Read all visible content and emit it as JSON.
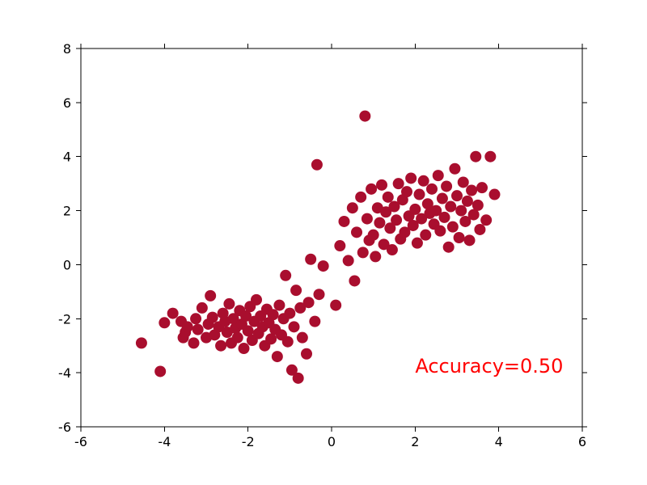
{
  "chart_data": {
    "type": "scatter",
    "title": "",
    "xlabel": "",
    "ylabel": "",
    "xlim": [
      -6,
      6
    ],
    "ylim": [
      -6,
      8
    ],
    "x_ticks": [
      -6,
      -4,
      -2,
      0,
      2,
      4,
      6
    ],
    "y_ticks": [
      -6,
      -4,
      -2,
      0,
      2,
      4,
      6,
      8
    ],
    "annotation": {
      "text": "Accuracy=0.50",
      "x": 2.0,
      "y": -4.0,
      "color": "#ff0000"
    },
    "marker_color": "#a90e2e",
    "marker_radius": 7,
    "series": [
      {
        "name": "points",
        "points": [
          [
            -4.55,
            -2.9
          ],
          [
            -4.1,
            -3.95
          ],
          [
            -4.0,
            -2.15
          ],
          [
            -3.8,
            -1.8
          ],
          [
            -3.6,
            -2.1
          ],
          [
            -3.55,
            -2.7
          ],
          [
            -3.5,
            -2.5
          ],
          [
            -3.45,
            -2.3
          ],
          [
            -3.3,
            -2.9
          ],
          [
            -3.25,
            -2.0
          ],
          [
            -3.2,
            -2.4
          ],
          [
            -3.1,
            -1.6
          ],
          [
            -3.0,
            -2.7
          ],
          [
            -2.95,
            -2.2
          ],
          [
            -2.9,
            -1.15
          ],
          [
            -2.85,
            -1.95
          ],
          [
            -2.8,
            -2.6
          ],
          [
            -2.7,
            -2.3
          ],
          [
            -2.65,
            -3.0
          ],
          [
            -2.6,
            -1.8
          ],
          [
            -2.55,
            -2.1
          ],
          [
            -2.5,
            -2.5
          ],
          [
            -2.45,
            -1.45
          ],
          [
            -2.4,
            -2.9
          ],
          [
            -2.35,
            -2.0
          ],
          [
            -2.3,
            -2.35
          ],
          [
            -2.25,
            -2.7
          ],
          [
            -2.2,
            -1.7
          ],
          [
            -2.15,
            -2.2
          ],
          [
            -2.1,
            -3.1
          ],
          [
            -2.05,
            -1.9
          ],
          [
            -2.0,
            -2.45
          ],
          [
            -1.95,
            -1.55
          ],
          [
            -1.9,
            -2.8
          ],
          [
            -1.85,
            -2.1
          ],
          [
            -1.8,
            -1.3
          ],
          [
            -1.75,
            -2.55
          ],
          [
            -1.7,
            -1.9
          ],
          [
            -1.65,
            -2.3
          ],
          [
            -1.6,
            -3.0
          ],
          [
            -1.55,
            -1.65
          ],
          [
            -1.5,
            -2.15
          ],
          [
            -1.45,
            -2.75
          ],
          [
            -1.4,
            -1.85
          ],
          [
            -1.35,
            -2.4
          ],
          [
            -1.3,
            -3.4
          ],
          [
            -1.25,
            -1.5
          ],
          [
            -1.2,
            -2.6
          ],
          [
            -1.15,
            -2.0
          ],
          [
            -1.1,
            -0.4
          ],
          [
            -1.05,
            -2.85
          ],
          [
            -1.0,
            -1.8
          ],
          [
            -0.95,
            -3.9
          ],
          [
            -0.9,
            -2.3
          ],
          [
            -0.85,
            -0.95
          ],
          [
            -0.8,
            -4.2
          ],
          [
            -0.75,
            -1.6
          ],
          [
            -0.7,
            -2.7
          ],
          [
            -0.6,
            -3.3
          ],
          [
            -0.55,
            -1.4
          ],
          [
            -0.5,
            0.2
          ],
          [
            -0.4,
            -2.1
          ],
          [
            -0.35,
            3.7
          ],
          [
            -0.3,
            -1.1
          ],
          [
            -0.2,
            -0.05
          ],
          [
            0.1,
            -1.5
          ],
          [
            0.2,
            0.7
          ],
          [
            0.3,
            1.6
          ],
          [
            0.4,
            0.15
          ],
          [
            0.5,
            2.1
          ],
          [
            0.55,
            -0.6
          ],
          [
            0.6,
            1.2
          ],
          [
            0.7,
            2.5
          ],
          [
            0.75,
            0.45
          ],
          [
            0.8,
            5.5
          ],
          [
            0.85,
            1.7
          ],
          [
            0.9,
            0.9
          ],
          [
            0.95,
            2.8
          ],
          [
            1.0,
            1.1
          ],
          [
            1.05,
            0.3
          ],
          [
            1.1,
            2.1
          ],
          [
            1.15,
            1.55
          ],
          [
            1.2,
            2.95
          ],
          [
            1.25,
            0.75
          ],
          [
            1.3,
            1.95
          ],
          [
            1.35,
            2.5
          ],
          [
            1.4,
            1.35
          ],
          [
            1.45,
            0.55
          ],
          [
            1.5,
            2.15
          ],
          [
            1.55,
            1.65
          ],
          [
            1.6,
            3.0
          ],
          [
            1.65,
            0.95
          ],
          [
            1.7,
            2.4
          ],
          [
            1.75,
            1.2
          ],
          [
            1.8,
            2.7
          ],
          [
            1.85,
            1.8
          ],
          [
            1.9,
            3.2
          ],
          [
            1.95,
            1.45
          ],
          [
            2.0,
            2.05
          ],
          [
            2.05,
            0.8
          ],
          [
            2.1,
            2.6
          ],
          [
            2.15,
            1.7
          ],
          [
            2.2,
            3.1
          ],
          [
            2.25,
            1.1
          ],
          [
            2.3,
            2.25
          ],
          [
            2.35,
            1.9
          ],
          [
            2.4,
            2.8
          ],
          [
            2.45,
            1.5
          ],
          [
            2.5,
            2.0
          ],
          [
            2.55,
            3.3
          ],
          [
            2.6,
            1.25
          ],
          [
            2.65,
            2.45
          ],
          [
            2.7,
            1.75
          ],
          [
            2.75,
            2.9
          ],
          [
            2.8,
            0.65
          ],
          [
            2.85,
            2.15
          ],
          [
            2.9,
            1.4
          ],
          [
            2.95,
            3.55
          ],
          [
            3.0,
            2.55
          ],
          [
            3.05,
            1.0
          ],
          [
            3.1,
            2.0
          ],
          [
            3.15,
            3.05
          ],
          [
            3.2,
            1.6
          ],
          [
            3.25,
            2.35
          ],
          [
            3.3,
            0.9
          ],
          [
            3.35,
            2.75
          ],
          [
            3.4,
            1.85
          ],
          [
            3.45,
            4.0
          ],
          [
            3.5,
            2.2
          ],
          [
            3.55,
            1.3
          ],
          [
            3.6,
            2.85
          ],
          [
            3.7,
            1.65
          ],
          [
            3.8,
            4.0
          ],
          [
            3.9,
            2.6
          ]
        ]
      }
    ]
  }
}
